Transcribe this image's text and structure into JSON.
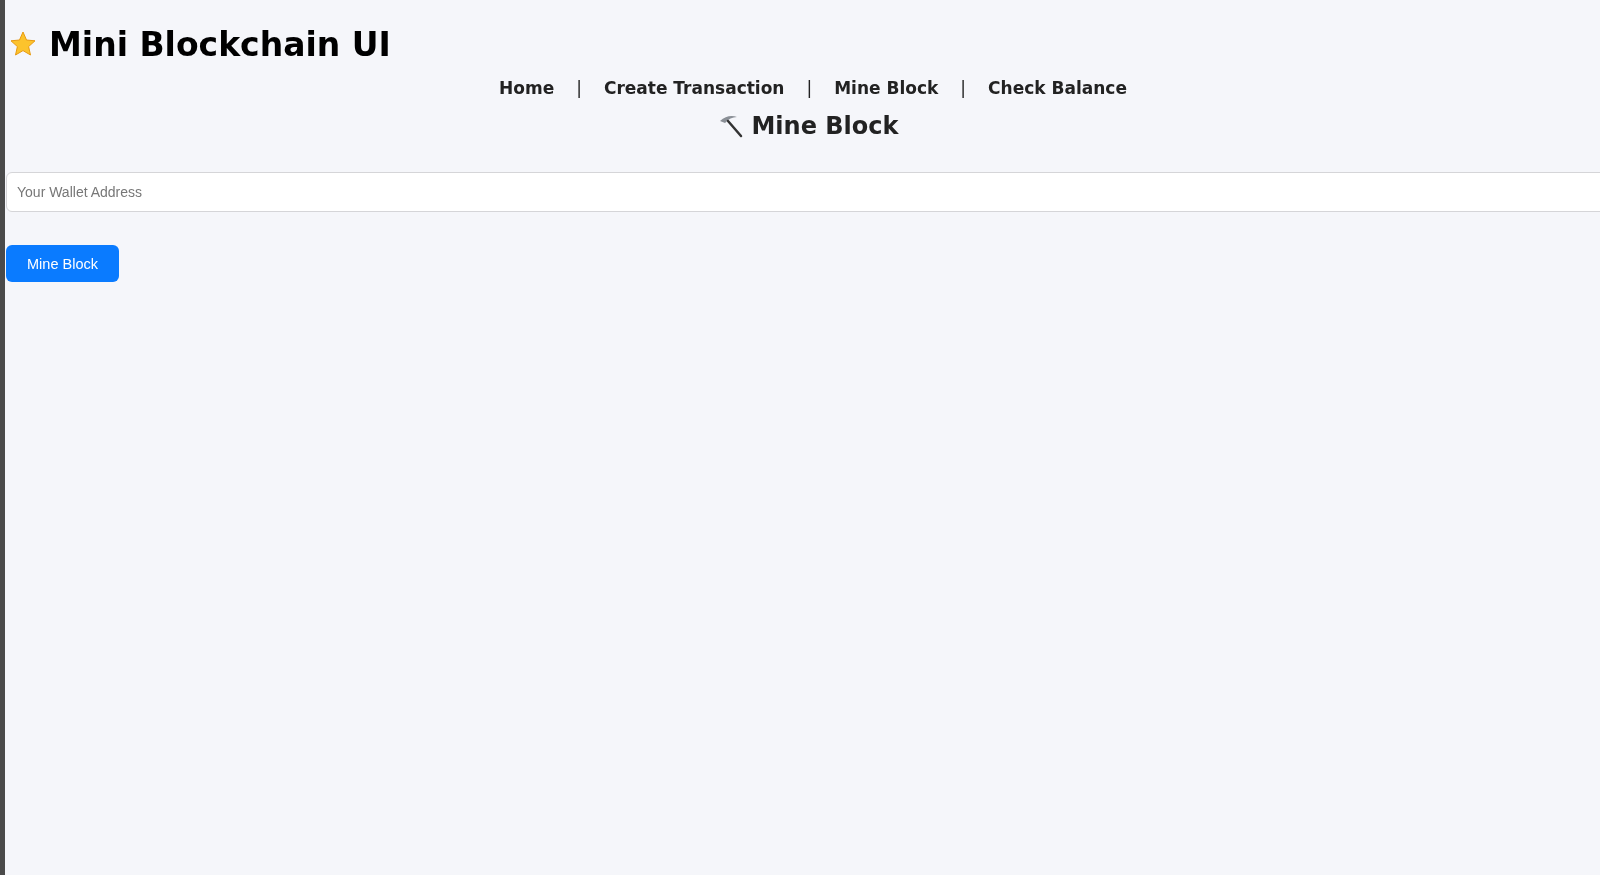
{
  "header": {
    "title": "Mini Blockchain UI"
  },
  "nav": {
    "items": [
      {
        "label": "Home"
      },
      {
        "label": "Create Transaction"
      },
      {
        "label": "Mine Block"
      },
      {
        "label": "Check Balance"
      }
    ],
    "separator": "|"
  },
  "section": {
    "title": "Mine Block"
  },
  "wallet_field": {
    "placeholder": "Your Wallet Address"
  },
  "mine_button": {
    "label": "Mine Block"
  }
}
